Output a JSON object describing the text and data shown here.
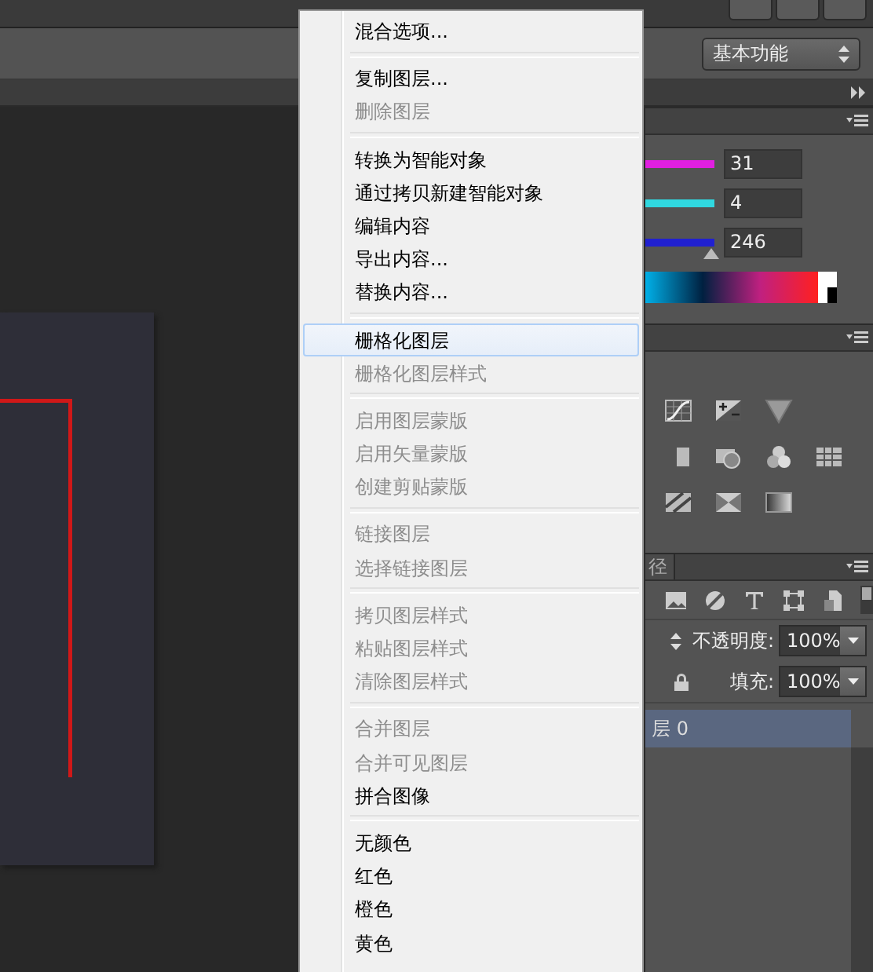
{
  "options_bar": {
    "workspace": "基本功能"
  },
  "color_panel": {
    "channels": [
      {
        "value": "31",
        "color": "#e020e0"
      },
      {
        "value": "4",
        "color": "#30d8e0"
      },
      {
        "value": "246",
        "level": 0.96,
        "color": "#2020d0"
      }
    ]
  },
  "layers_panel": {
    "tab": "径",
    "opacity_label": "不透明度:",
    "opacity": "100%",
    "fill_label": "填充:",
    "fill": "100%",
    "filter_on": false,
    "layers": [
      {
        "name": "层 0",
        "selected": true
      }
    ]
  },
  "context_menu": {
    "groups": [
      [
        {
          "label": "混合选项...",
          "disabled": false,
          "selected": false
        }
      ],
      [
        {
          "label": "复制图层...",
          "disabled": false,
          "selected": false
        },
        {
          "label": "删除图层",
          "disabled": true,
          "selected": false
        }
      ],
      [
        {
          "label": "转换为智能对象",
          "disabled": false,
          "selected": false
        },
        {
          "label": "通过拷贝新建智能对象",
          "disabled": false,
          "selected": false
        },
        {
          "label": "编辑内容",
          "disabled": false,
          "selected": false
        },
        {
          "label": "导出内容...",
          "disabled": false,
          "selected": false
        },
        {
          "label": "替换内容...",
          "disabled": false,
          "selected": false
        }
      ],
      [
        {
          "label": "栅格化图层",
          "disabled": false,
          "selected": true
        },
        {
          "label": "栅格化图层样式",
          "disabled": true,
          "selected": false
        }
      ],
      [
        {
          "label": "启用图层蒙版",
          "disabled": true,
          "selected": false
        },
        {
          "label": "启用矢量蒙版",
          "disabled": true,
          "selected": false
        },
        {
          "label": "创建剪贴蒙版",
          "disabled": true,
          "selected": false
        }
      ],
      [
        {
          "label": "链接图层",
          "disabled": true,
          "selected": false
        },
        {
          "label": "选择链接图层",
          "disabled": true,
          "selected": false
        }
      ],
      [
        {
          "label": "拷贝图层样式",
          "disabled": true,
          "selected": false
        },
        {
          "label": "粘贴图层样式",
          "disabled": true,
          "selected": false
        },
        {
          "label": "清除图层样式",
          "disabled": true,
          "selected": false
        }
      ],
      [
        {
          "label": "合并图层",
          "disabled": true,
          "selected": false
        },
        {
          "label": "合并可见图层",
          "disabled": true,
          "selected": false
        },
        {
          "label": "拼合图像",
          "disabled": false,
          "selected": false
        }
      ],
      [
        {
          "label": "无颜色",
          "disabled": false,
          "selected": false
        },
        {
          "label": "红色",
          "disabled": false,
          "selected": false
        },
        {
          "label": "橙色",
          "disabled": false,
          "selected": false
        },
        {
          "label": "黄色",
          "disabled": false,
          "selected": false
        }
      ]
    ]
  }
}
